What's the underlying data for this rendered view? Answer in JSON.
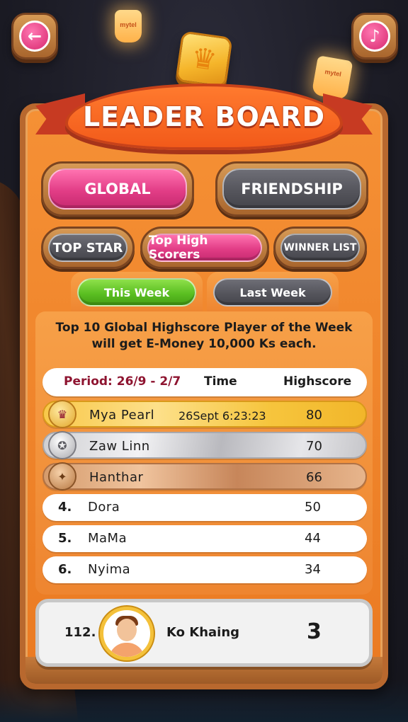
{
  "header": {
    "title": "LEADER BOARD",
    "back_icon": "arrow-left-icon",
    "music_icon": "music-note-icon",
    "lantern_label": "mytel"
  },
  "scope_tabs": [
    {
      "label": "GLOBAL",
      "active": true
    },
    {
      "label": "FRIENDSHIP",
      "active": false
    }
  ],
  "category_tabs": [
    {
      "label": "TOP STAR",
      "active": false
    },
    {
      "label": "Top High Scorers",
      "active": true
    },
    {
      "label": "WINNER LIST",
      "active": false
    }
  ],
  "week_tabs": [
    {
      "label": "This Week",
      "active": true
    },
    {
      "label": "Last Week",
      "active": false
    }
  ],
  "promo": {
    "line1": "Top 10 Global Highscore Player of the Week",
    "line2": "will get E-Money 10,000 Ks each."
  },
  "table": {
    "period": "Period: 26/9 - 2/7",
    "col_time": "Time",
    "col_score": "Highscore",
    "rows": [
      {
        "rank": "1",
        "name": "Mya Pearl",
        "time": "26Sept 6:23:23",
        "score": "80",
        "medal": "gold-medal-icon"
      },
      {
        "rank": "2",
        "name": "Zaw Linn",
        "time": "",
        "score": "70",
        "medal": "silver-medal-icon"
      },
      {
        "rank": "3",
        "name": "Hanthar",
        "time": "",
        "score": "66",
        "medal": "bronze-medal-icon"
      },
      {
        "rank": "4.",
        "name": "Dora",
        "time": "",
        "score": "50"
      },
      {
        "rank": "5.",
        "name": "MaMa",
        "time": "",
        "score": "44"
      },
      {
        "rank": "6.",
        "name": "Nyima",
        "time": "",
        "score": "34"
      }
    ]
  },
  "me": {
    "rank": "112.",
    "name": "Ko Khaing",
    "score": "3"
  },
  "colors": {
    "panel": "#f08a2e",
    "pink_button": "#e23d86",
    "gray_button": "#55555c",
    "green_button": "#5bbf22",
    "period_text": "#8e1430"
  }
}
